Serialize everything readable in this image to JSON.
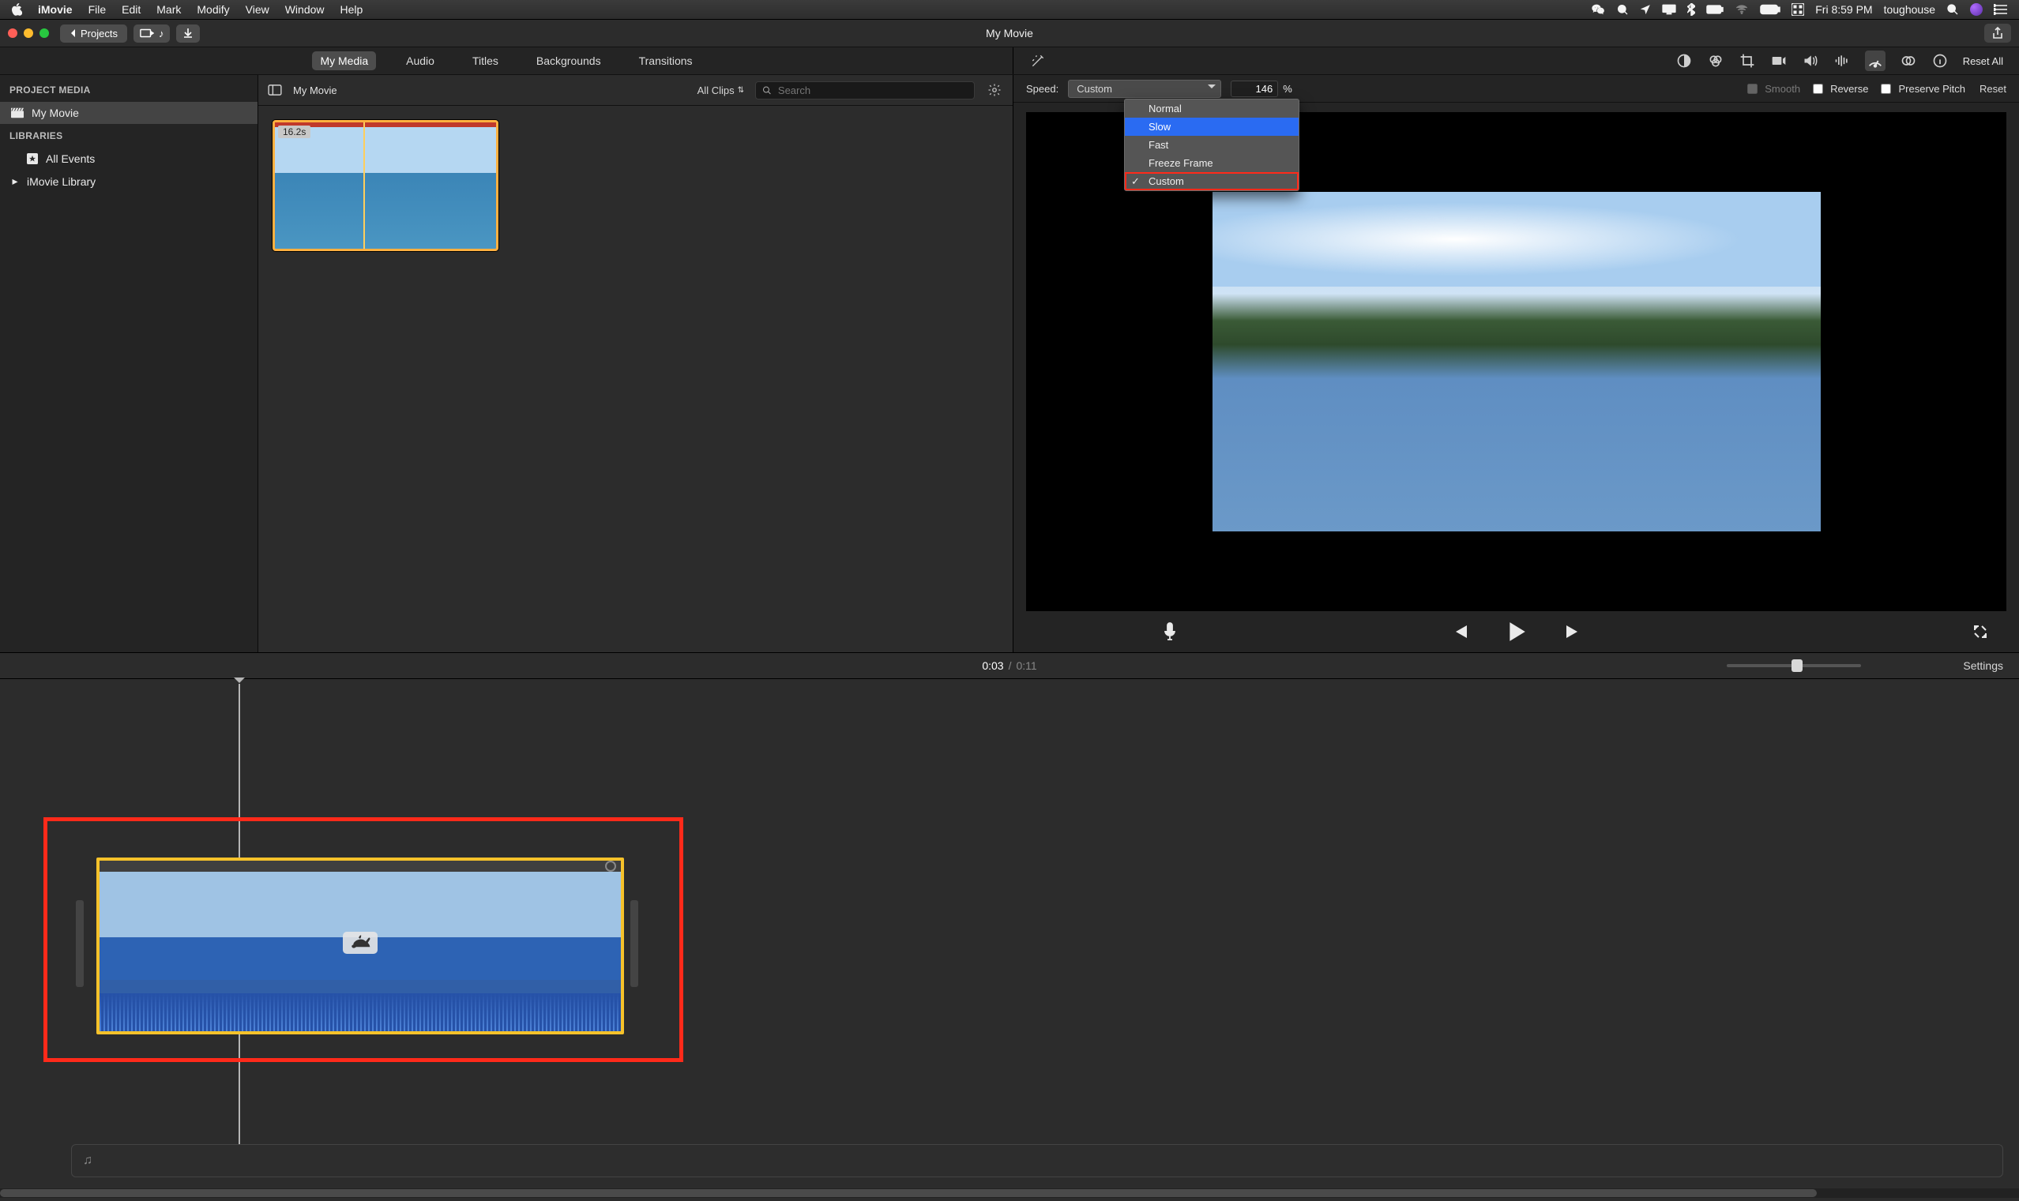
{
  "menubar": {
    "app": "iMovie",
    "items": [
      "File",
      "Edit",
      "Mark",
      "Modify",
      "View",
      "Window",
      "Help"
    ],
    "clock": "Fri 8:59 PM",
    "user": "toughouse"
  },
  "window": {
    "title": "My Movie",
    "back_label": "Projects"
  },
  "content_tabs": [
    "My Media",
    "Audio",
    "Titles",
    "Backgrounds",
    "Transitions"
  ],
  "content_tabs_active": 0,
  "sidebar": {
    "project_media_hdr": "PROJECT MEDIA",
    "project": "My Movie",
    "libraries_hdr": "LIBRARIES",
    "libraries": [
      "All Events",
      "iMovie Library"
    ]
  },
  "media_top": {
    "project_title": "My Movie",
    "all_clips_label": "All Clips",
    "search_placeholder": "Search"
  },
  "clip": {
    "duration": "16.2s"
  },
  "inspector": {
    "reset_all": "Reset All",
    "speed_label": "Speed:",
    "speed_select_value": "Custom",
    "speed_pct": "146",
    "pct_sign": "%",
    "smooth": "Smooth",
    "reverse": "Reverse",
    "preserve": "Preserve Pitch",
    "reset": "Reset"
  },
  "speed_dropdown": {
    "options": [
      "Normal",
      "Slow",
      "Fast",
      "Freeze Frame",
      "Custom"
    ],
    "hover_index": 1,
    "checked_index": 4,
    "highlight_index": 4
  },
  "transport": {
    "current": "0:03",
    "total": "0:11"
  },
  "settings_label": "Settings"
}
